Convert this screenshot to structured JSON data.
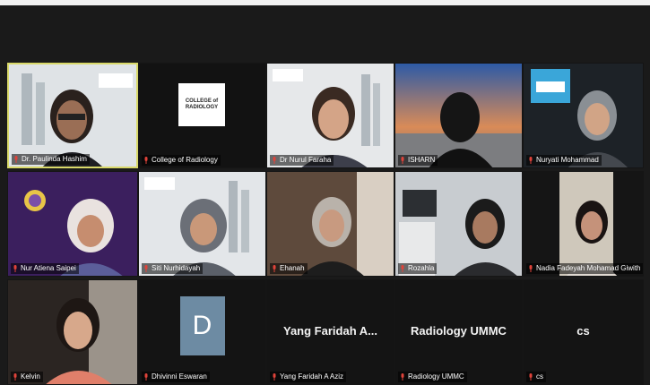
{
  "colors": {
    "background": "#1a1a1a",
    "tile": "#0e0e0e",
    "active_border": "#d9d96a",
    "mic_muted": "#e0433a",
    "avatar_d": "#6d8ba3"
  },
  "participants": [
    {
      "name": "Dr. Paulinda Hashim",
      "active": true
    },
    {
      "name": "College of Radiology"
    },
    {
      "name": "Dr Nurul Faraha"
    },
    {
      "name": "ISHARN"
    },
    {
      "name": "Nuryati Mohammad"
    },
    {
      "name": "Nur Atiena Saipei"
    },
    {
      "name": "Siti Nurhidayah"
    },
    {
      "name": "Ehanah"
    },
    {
      "name": "Rozahla"
    },
    {
      "name": "Nadia Fadeyah Mohamad Giwith"
    },
    {
      "name": "Kelvin"
    },
    {
      "name": "Dhivinni Eswaran",
      "avatar_letter": "D"
    },
    {
      "name": "Yang Faridah A Aziz",
      "display_label": "Yang Faridah A..."
    },
    {
      "name": "Radiology UMMC",
      "display_label": "Radiology UMMC"
    },
    {
      "name": "cs",
      "display_label": "cs"
    }
  ],
  "logo_text": "COLLEGE of RADIOLOGY",
  "icons": {
    "mic": "mic-muted-icon"
  }
}
